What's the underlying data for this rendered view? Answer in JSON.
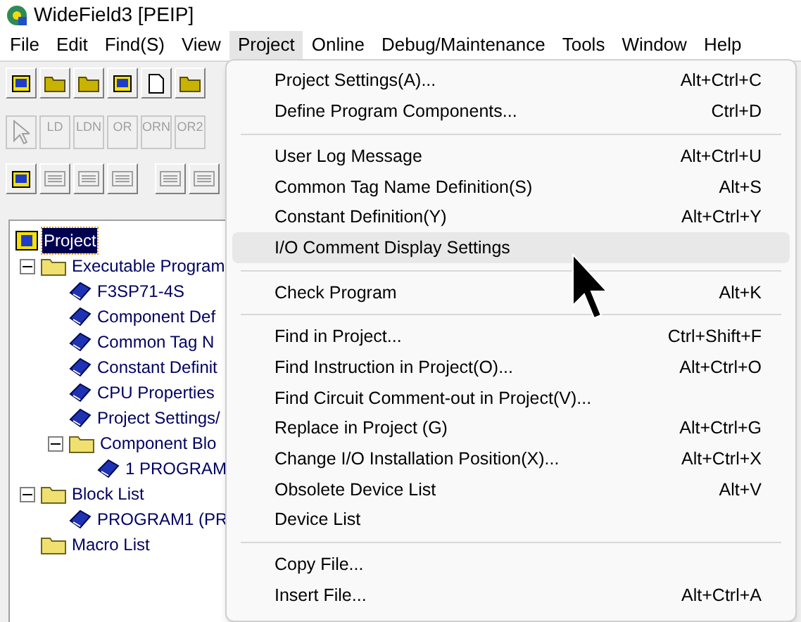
{
  "window": {
    "title": "WideField3 [PEIP]"
  },
  "menu_bar": [
    {
      "label": "File",
      "selected": false
    },
    {
      "label": "Edit",
      "selected": false
    },
    {
      "label": "Find(S)",
      "selected": false
    },
    {
      "label": "View",
      "selected": false
    },
    {
      "label": "Project",
      "selected": true
    },
    {
      "label": "Online",
      "selected": false
    },
    {
      "label": "Debug/Maintenance",
      "selected": false
    },
    {
      "label": "Tools",
      "selected": false
    },
    {
      "label": "Window",
      "selected": false
    },
    {
      "label": "Help",
      "selected": false
    }
  ],
  "ladder_toolbar": [
    {
      "label": "LD",
      "disabled": true
    },
    {
      "label": "LDN",
      "disabled": true
    },
    {
      "label": "OR",
      "disabled": true
    },
    {
      "label": "ORN",
      "disabled": true
    },
    {
      "label": "OR2",
      "disabled": true
    }
  ],
  "project_tree": [
    {
      "label": "Project",
      "kind": "project",
      "selected": true,
      "children": [
        {
          "label": "Executable Program",
          "kind": "folder",
          "selected": false,
          "expanded": true,
          "children": [
            {
              "label": "F3SP71-4S",
              "kind": "book",
              "selected": false
            },
            {
              "label": "Component Def",
              "kind": "book",
              "selected": false
            },
            {
              "label": "Common Tag N",
              "kind": "book",
              "selected": false
            },
            {
              "label": "Constant Definit",
              "kind": "book",
              "selected": false
            },
            {
              "label": "CPU Properties",
              "kind": "book",
              "selected": false
            },
            {
              "label": "Project Settings/",
              "kind": "book",
              "selected": false
            },
            {
              "label": "Component Blo",
              "kind": "folder",
              "selected": false,
              "expanded": true,
              "children": [
                {
                  "label": "1 PROGRAM",
                  "kind": "book",
                  "selected": false
                }
              ]
            }
          ]
        },
        {
          "label": "Block List",
          "kind": "folder",
          "selected": false,
          "expanded": true,
          "children": [
            {
              "label": "PROGRAM1 (PR",
              "kind": "book",
              "selected": false
            }
          ]
        },
        {
          "label": "Macro List",
          "kind": "folder",
          "selected": false
        }
      ]
    }
  ],
  "project_menu": [
    {
      "kind": "item",
      "label": "Project Settings(A)...",
      "shortcut": "Alt+Ctrl+C",
      "selected": false
    },
    {
      "kind": "item",
      "label": "Define Program Components...",
      "shortcut": "Ctrl+D",
      "selected": false
    },
    {
      "kind": "separator"
    },
    {
      "kind": "item",
      "label": "User Log Message",
      "shortcut": "Alt+Ctrl+U",
      "selected": false
    },
    {
      "kind": "item",
      "label": "Common Tag Name Definition(S)",
      "shortcut": "Alt+S",
      "selected": false
    },
    {
      "kind": "item",
      "label": "Constant Definition(Y)",
      "shortcut": "Alt+Ctrl+Y",
      "selected": false
    },
    {
      "kind": "item",
      "label": "I/O Comment Display Settings",
      "selected": true
    },
    {
      "kind": "separator"
    },
    {
      "kind": "item",
      "label": "Check Program",
      "shortcut": "Alt+K",
      "selected": false
    },
    {
      "kind": "separator"
    },
    {
      "kind": "item",
      "label": "Find in Project...",
      "shortcut": "Ctrl+Shift+F",
      "selected": false
    },
    {
      "kind": "item",
      "label": "Find Instruction in Project(O)...",
      "shortcut": "Alt+Ctrl+O",
      "selected": false
    },
    {
      "kind": "item",
      "label": "Find Circuit Comment-out in Project(V)...",
      "selected": false
    },
    {
      "kind": "item",
      "label": "Replace in Project (G)",
      "shortcut": "Alt+Ctrl+G",
      "selected": false
    },
    {
      "kind": "item",
      "label": "Change I/O Installation Position(X)...",
      "shortcut": "Alt+Ctrl+X",
      "selected": false
    },
    {
      "kind": "item",
      "label": "Obsolete Device List",
      "shortcut": "Alt+V",
      "selected": false
    },
    {
      "kind": "item",
      "label": "Device List",
      "selected": false
    },
    {
      "kind": "separator"
    },
    {
      "kind": "item",
      "label": "Copy File...",
      "selected": false
    },
    {
      "kind": "item",
      "label": "Insert File...",
      "shortcut": "Alt+Ctrl+A",
      "selected": false
    }
  ]
}
